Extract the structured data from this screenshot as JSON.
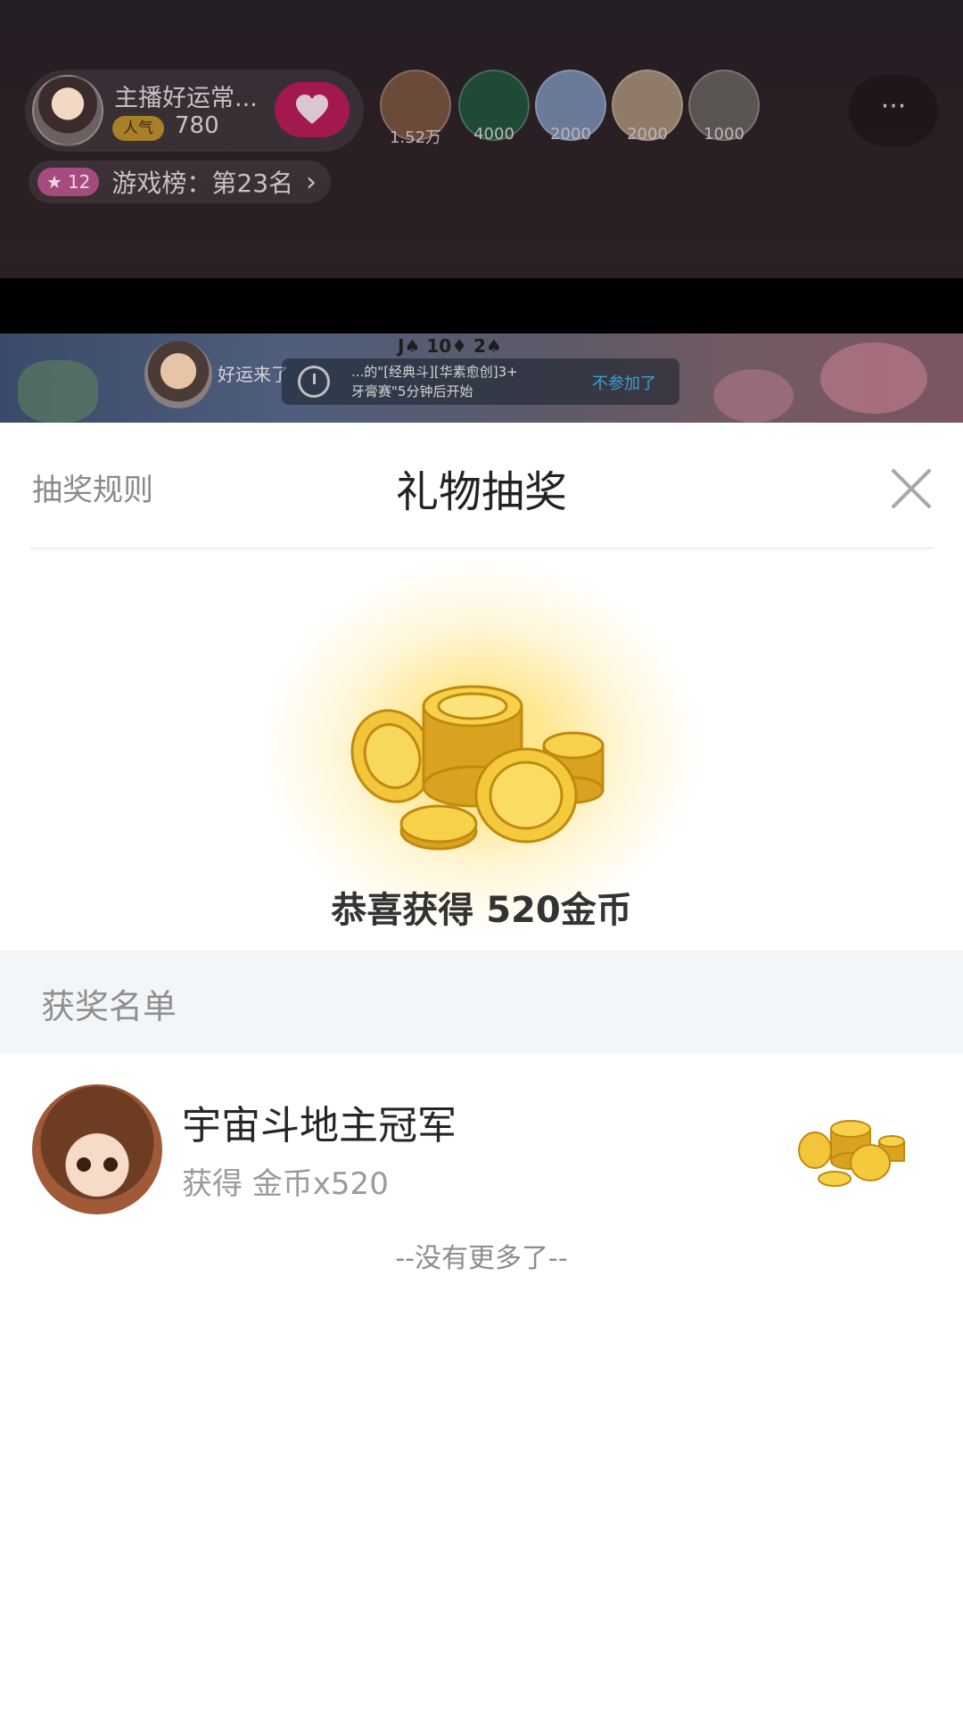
{
  "room": {
    "host_name": "主播好运常...",
    "popularity_label": "人气",
    "popularity_count": "780",
    "fans": [
      {
        "value": "1.52万",
        "color": "#6b4a3a"
      },
      {
        "value": "4000",
        "color": "#1f4a35"
      },
      {
        "value": "2000",
        "color": "#6a7a98"
      },
      {
        "value": "2000",
        "color": "#8f7b68"
      },
      {
        "value": "1000",
        "color": "#5b5552"
      }
    ],
    "more_label": "···",
    "level_badge": "12",
    "rank_text": "游戏榜：第23名",
    "rank_chevron": "›"
  },
  "game_strip": {
    "luck_text": "好运来了",
    "cards_text": "J♠ 10♦ 2♠",
    "notice_line1": "...的\"[经典斗][华素愈创]3+",
    "notice_line2": "牙膏赛\"5分钟后开始",
    "notice_action": "不参加了"
  },
  "sheet": {
    "rules_label": "抽奖规则",
    "title": "礼物抽奖",
    "prize_text": "恭喜获得 520金币",
    "list_title": "获奖名单",
    "winners": [
      {
        "name": "宇宙斗地主冠军",
        "reward": "获得 金币x520"
      }
    ],
    "no_more_text": "--没有更多了--"
  },
  "colors": {
    "accent_pink": "#a3194f",
    "coin_gold": "#f8d44a",
    "list_header_bg": "#f3f6f9"
  }
}
